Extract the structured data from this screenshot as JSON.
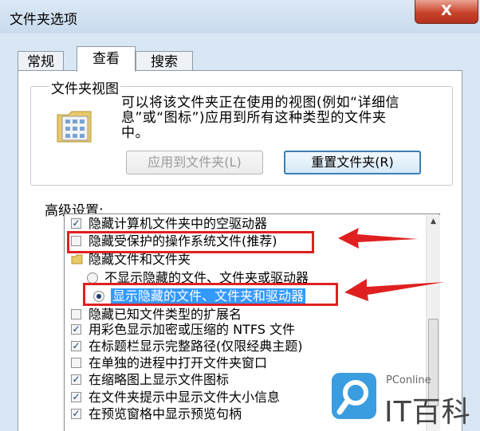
{
  "window": {
    "title": "文件夹选项",
    "close_label": "X"
  },
  "tabs": [
    {
      "label": "常规",
      "active": false
    },
    {
      "label": "查看",
      "active": true
    },
    {
      "label": "搜索",
      "active": false
    }
  ],
  "folder_views": {
    "group_label": "文件夹视图",
    "description_line1": "可以将该文件夹正在使用的视图(例如“详细信",
    "description_line2": "息”或“图标”)应用到所有这种类型的文件夹",
    "description_line3": "中。",
    "apply_button": "应用到文件夹(L)",
    "reset_button": "重置文件夹(R)"
  },
  "advanced": {
    "label": "高级设置:",
    "items": [
      {
        "label": "隐藏计算机文件夹中的空驱动器",
        "type": "checkbox",
        "checked": true
      },
      {
        "label": "隐藏受保护的操作系统文件(推荐)",
        "type": "checkbox",
        "checked": false
      },
      {
        "label": "隐藏文件和文件夹",
        "type": "folder"
      },
      {
        "label": "不显示隐藏的文件、文件夹或驱动器",
        "type": "radio",
        "checked": false
      },
      {
        "label": "显示隐藏的文件、文件夹和驱动器",
        "type": "radio",
        "checked": true
      },
      {
        "label": "隐藏已知文件类型的扩展名",
        "type": "checkbox",
        "checked": false
      },
      {
        "label": "用彩色显示加密或压缩的 NTFS 文件",
        "type": "checkbox",
        "checked": true
      },
      {
        "label": "在标题栏显示完整路径(仅限经典主题)",
        "type": "checkbox",
        "checked": true
      },
      {
        "label": "在单独的进程中打开文件夹窗口",
        "type": "checkbox",
        "checked": false
      },
      {
        "label": "在缩略图上显示文件图标",
        "type": "checkbox",
        "checked": true
      },
      {
        "label": "在文件夹提示中显示文件大小信息",
        "type": "checkbox",
        "checked": true
      },
      {
        "label": "在预览窗格中显示预览句柄",
        "type": "checkbox",
        "checked": true
      }
    ]
  },
  "watermark": {
    "sub": "PConline",
    "main": "IT百科"
  },
  "colors": {
    "highlight": "#e02020",
    "selection": "#3399ff"
  }
}
